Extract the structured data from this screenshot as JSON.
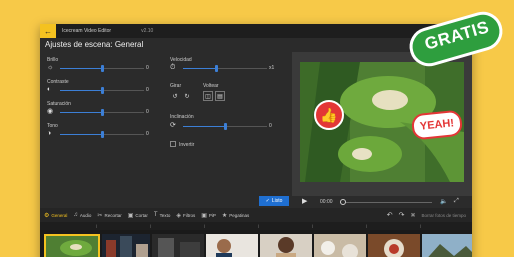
{
  "window": {
    "app_name": "Icecream Video Editor",
    "version": "v2.10",
    "back_icon": "arrow-left-icon"
  },
  "scene": {
    "title": "Ajustes de escena: General"
  },
  "settings": {
    "brightness": {
      "label": "Brillo",
      "value": "0",
      "level": 0.5
    },
    "contrast": {
      "label": "Contraste",
      "value": "0",
      "level": 0.5
    },
    "saturation": {
      "label": "Saturación",
      "value": "0",
      "level": 0.5
    },
    "tone": {
      "label": "Tono",
      "value": "0",
      "level": 0.5
    },
    "speed": {
      "label": "Velocidad",
      "value": "x1",
      "level": 0.4
    },
    "rotate": {
      "label": "Girar"
    },
    "flip": {
      "label": "Voltear"
    },
    "tilt": {
      "label": "Inclinación",
      "value": "0",
      "level": 0.5
    },
    "invert": {
      "label": "Invertir",
      "checked": false
    },
    "done_label": "Listo"
  },
  "preview": {
    "time_current": "00:00",
    "badge_text": "YEAH!"
  },
  "toolbar": {
    "tools": [
      {
        "label": "General",
        "active": true
      },
      {
        "label": "Audio"
      },
      {
        "label": "Recortar"
      },
      {
        "label": "Cortar"
      },
      {
        "label": "Texto"
      },
      {
        "label": "Filtros"
      },
      {
        "label": "PiP"
      },
      {
        "label": "Pegatinas"
      }
    ],
    "remove_label": "Borrar fotos de tiempo"
  },
  "promo": {
    "label": "GRATIS"
  },
  "colors": {
    "accent": "#f4c220",
    "slider": "#3c7fd6",
    "promo_bg": "#2e9e3e",
    "done": "#1f6fd1"
  }
}
